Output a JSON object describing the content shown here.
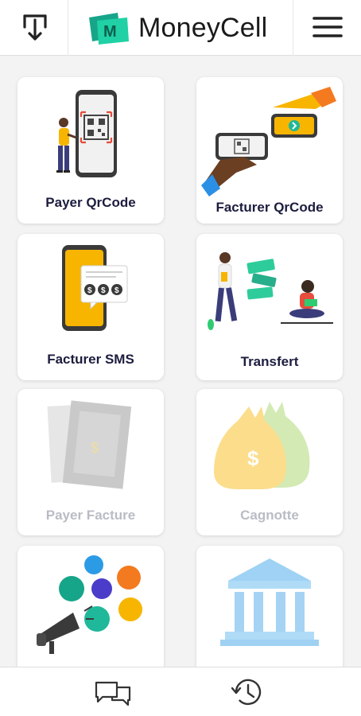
{
  "app": {
    "name": "MoneyCell",
    "logo_letter": "M"
  },
  "header": {
    "left_icon": "download-icon",
    "right_icon": "hamburger-menu-icon"
  },
  "tiles": [
    {
      "label": "Payer QrCode",
      "icon": "qrcode-phone-illustration",
      "enabled": true
    },
    {
      "label": "Facturer QrCode",
      "icon": "qrcode-handoff-illustration",
      "enabled": true
    },
    {
      "label": "Facturer SMS",
      "icon": "sms-invoice-illustration",
      "enabled": true
    },
    {
      "label": "Transfert",
      "icon": "money-transfer-illustration",
      "enabled": true
    },
    {
      "label": "Payer Facture",
      "icon": "invoice-illustration",
      "enabled": false
    },
    {
      "label": "Cagnotte",
      "icon": "money-bags-illustration",
      "enabled": false
    },
    {
      "label": "",
      "icon": "marketing-megaphone-illustration",
      "enabled": true
    },
    {
      "label": "",
      "icon": "bank-building-illustration",
      "enabled": false
    }
  ],
  "bottom_nav": [
    {
      "icon": "chat-icon"
    },
    {
      "icon": "history-icon"
    }
  ],
  "colors": {
    "brand_teal": "#1fb89a",
    "label_text": "#1c1d3e",
    "label_disabled": "#b9bcc4",
    "accent_yellow": "#f7b500",
    "accent_orange": "#f47a20"
  }
}
